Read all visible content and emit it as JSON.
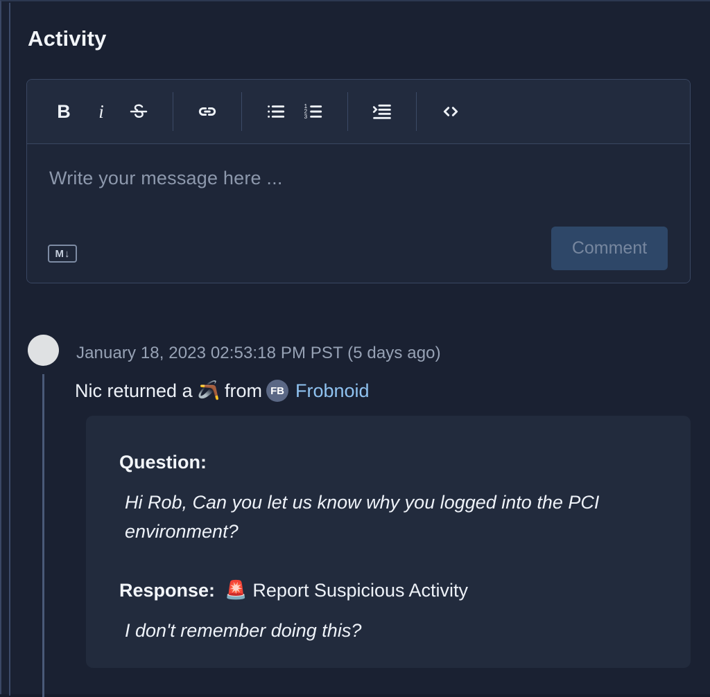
{
  "panel": {
    "title": "Activity"
  },
  "composer": {
    "toolbar": [
      {
        "name": "bold-icon",
        "label": "B"
      },
      {
        "name": "italic-icon",
        "label": "i"
      },
      {
        "name": "strikethrough-icon",
        "label": "S"
      },
      {
        "name": "link-icon",
        "label": "link"
      },
      {
        "name": "bulleted-list-icon",
        "label": "bulleted list"
      },
      {
        "name": "numbered-list-icon",
        "label": "numbered list"
      },
      {
        "name": "blockquote-icon",
        "label": "blockquote"
      },
      {
        "name": "code-icon",
        "label": "<>"
      }
    ],
    "placeholder": "Write your message here ...",
    "markdown_badge": "M",
    "markdown_badge_arrow": "↓",
    "submit_label": "Comment"
  },
  "activity": [
    {
      "timestamp": "January 18, 2023 02:53:18 PM PST (5 days ago)",
      "summary_prefix": "Nic returned a",
      "summary_emoji": "🪃",
      "summary_middle": "from",
      "org_badge": "FB",
      "org_name": "Frobnoid",
      "card": {
        "question_label": "Question:",
        "question_text": "Hi Rob, Can you let us know why you logged into the PCI environment?",
        "response_label": "Response:",
        "response_emoji": "🚨",
        "response_value": "Report Suspicious Activity",
        "response_text": "I don't remember doing this?"
      }
    }
  ],
  "colors": {
    "background": "#1a2132",
    "surface": "#222b3d",
    "border": "#3a4762",
    "accent_link": "#8fc2f0",
    "button": "#2e4768",
    "thread_line": "#4a5a78"
  }
}
